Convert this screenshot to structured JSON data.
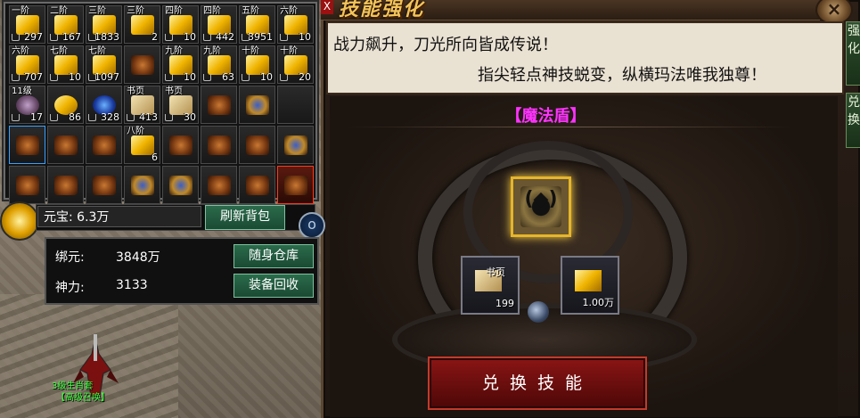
{
  "bag": {
    "cells": [
      {
        "label": "一阶",
        "qty": "297",
        "item": "gold-ingot",
        "lock": true
      },
      {
        "label": "二阶",
        "qty": "167",
        "item": "gold-ingot",
        "lock": true
      },
      {
        "label": "三阶",
        "qty": "1833",
        "item": "gold-ingot",
        "lock": true
      },
      {
        "label": "三阶",
        "qty": "2",
        "item": "gold-ingot",
        "lock": false
      },
      {
        "label": "四阶",
        "qty": "10",
        "item": "gold-ingot",
        "lock": true
      },
      {
        "label": "四阶",
        "qty": "442",
        "item": "gold-ingot",
        "lock": true
      },
      {
        "label": "五阶",
        "qty": "3951",
        "item": "gold-ingot",
        "lock": true
      },
      {
        "label": "六阶",
        "qty": "10",
        "item": "gold-ingot",
        "lock": true
      },
      {
        "label": "六阶",
        "qty": "707",
        "item": "gold-ingot",
        "lock": true
      },
      {
        "label": "七阶",
        "qty": "10",
        "item": "gold-ingot",
        "lock": true
      },
      {
        "label": "七阶",
        "qty": "1097",
        "item": "gold-ingot",
        "lock": true
      },
      {
        "label": "",
        "qty": "",
        "item": "gear",
        "lock": false
      },
      {
        "label": "九阶",
        "qty": "10",
        "item": "gold-ingot",
        "lock": true
      },
      {
        "label": "九阶",
        "qty": "63",
        "item": "gold-ingot",
        "lock": true
      },
      {
        "label": "十阶",
        "qty": "10",
        "item": "gold-ingot",
        "lock": true
      },
      {
        "label": "十阶",
        "qty": "20",
        "item": "gold-ingot",
        "lock": true
      },
      {
        "label": "11级",
        "qty": "17",
        "item": "pouch",
        "lock": true
      },
      {
        "label": "",
        "qty": "86",
        "item": "gold-orb",
        "lock": true
      },
      {
        "label": "",
        "qty": "328",
        "item": "blue-gem",
        "lock": true
      },
      {
        "label": "书页",
        "qty": "413",
        "item": "book-page",
        "lock": true
      },
      {
        "label": "书页",
        "qty": "30",
        "item": "book-page",
        "lock": true
      },
      {
        "label": "",
        "qty": "",
        "item": "gear",
        "lock": false
      },
      {
        "label": "",
        "qty": "",
        "item": "gear2",
        "lock": false
      },
      {
        "label": "",
        "qty": "",
        "item": "empty",
        "lock": false
      },
      {
        "label": "",
        "qty": "",
        "item": "gear",
        "lock": false,
        "selected": true
      },
      {
        "label": "",
        "qty": "",
        "item": "gear",
        "lock": false
      },
      {
        "label": "",
        "qty": "",
        "item": "gear",
        "lock": false
      },
      {
        "label": "八阶",
        "qty": "6",
        "item": "gold-ingot",
        "lock": false
      },
      {
        "label": "",
        "qty": "",
        "item": "gear",
        "lock": false
      },
      {
        "label": "",
        "qty": "",
        "item": "gear",
        "lock": false
      },
      {
        "label": "",
        "qty": "",
        "item": "gear",
        "lock": false
      },
      {
        "label": "",
        "qty": "",
        "item": "gear2",
        "lock": false
      },
      {
        "label": "",
        "qty": "",
        "item": "gear",
        "lock": false
      },
      {
        "label": "",
        "qty": "",
        "item": "gear",
        "lock": false
      },
      {
        "label": "",
        "qty": "",
        "item": "gear",
        "lock": false
      },
      {
        "label": "",
        "qty": "",
        "item": "gear2",
        "lock": false
      },
      {
        "label": "",
        "qty": "",
        "item": "gear2",
        "lock": false
      },
      {
        "label": "",
        "qty": "",
        "item": "gear",
        "lock": false
      },
      {
        "label": "",
        "qty": "",
        "item": "gear",
        "lock": false
      },
      {
        "label": "",
        "qty": "",
        "item": "red-item",
        "lock": false,
        "red": true
      }
    ],
    "yuanbao_text": "元宝: 6.3万",
    "refresh_label": "刷新背包",
    "bind_label": "绑元:",
    "bind_value": "3848万",
    "power_label": "神力:",
    "power_value": "3133",
    "warehouse_label": "随身仓库",
    "recycle_label": "装备回收"
  },
  "character": {
    "name": "3级生肖套",
    "guild": "【高级召唤】"
  },
  "skill": {
    "title_art": "技能强化",
    "desc_line1": "战力飙升，刀光所向皆成传说！",
    "desc_line2": "指尖轻点神技蜕变，纵横玛法唯我独尊！",
    "side_tab1": "强化",
    "side_tab2": "兑换",
    "skill_name": "【魔法盾】",
    "skill_glyph": "(◆)",
    "cost1_label": "书页",
    "cost1_qty": "199",
    "cost2_qty": "1.00万",
    "exchange_label": "兑换技能",
    "close_label": "×",
    "close_x": "X"
  },
  "colors": {
    "accent_gold": "#e6b52a",
    "skill_name": "#ff33ff",
    "button_green": "#2b6b4b",
    "exchange_red": "#8a1515",
    "char_name": "#3cff3c"
  }
}
